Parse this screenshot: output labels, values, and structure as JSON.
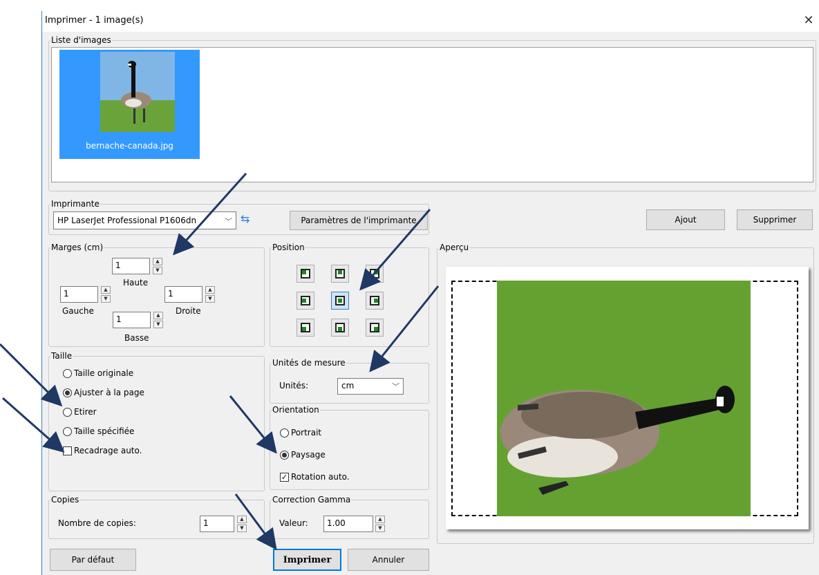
{
  "dialog": {
    "title": "Imprimer - 1 image(s)",
    "close_icon": "close-icon"
  },
  "image_list": {
    "legend": "Liste d'images",
    "items": [
      {
        "filename": "bernache-canada.jpg",
        "selected": true
      }
    ]
  },
  "printer": {
    "legend": "Imprimante",
    "selected": "HP LaserJet Professional P1606dn",
    "settings_label": "Paramètres de l'imprimante",
    "refresh_icon": "refresh-icon"
  },
  "buttons": {
    "add": "Ajout",
    "remove": "Supprimer",
    "default": "Par défaut",
    "print": "Imprimer",
    "cancel": "Annuler"
  },
  "margins": {
    "legend": "Marges (cm)",
    "top_label": "Haute",
    "top_value": "1",
    "left_label": "Gauche",
    "left_value": "1",
    "right_label": "Droite",
    "right_value": "1",
    "bottom_label": "Basse",
    "bottom_value": "1"
  },
  "position": {
    "legend": "Position",
    "selected": "center"
  },
  "preview": {
    "legend": "Aperçu"
  },
  "size": {
    "legend": "Taille",
    "options": [
      "Taille originale",
      "Ajuster à la page",
      "Etirer",
      "Taille spécifiée"
    ],
    "selected_index": 1,
    "auto_crop_label": "Recadrage auto.",
    "auto_crop_checked": false
  },
  "units": {
    "legend": "Unités de mesure",
    "label": "Unités:",
    "value": "cm"
  },
  "orientation": {
    "legend": "Orientation",
    "portrait": "Portrait",
    "landscape": "Paysage",
    "selected": "landscape",
    "auto_rotate_label": "Rotation auto.",
    "auto_rotate_checked": true
  },
  "copies": {
    "legend": "Copies",
    "label": "Nombre de copies:",
    "value": "1"
  },
  "gamma": {
    "legend": "Correction Gamma",
    "label": "Valeur:",
    "value": "1.00"
  },
  "colors": {
    "accent": "#3399ff",
    "arrow": "#1f3864",
    "dot": "#1e8a1e",
    "grass": "#5f9a2e"
  }
}
